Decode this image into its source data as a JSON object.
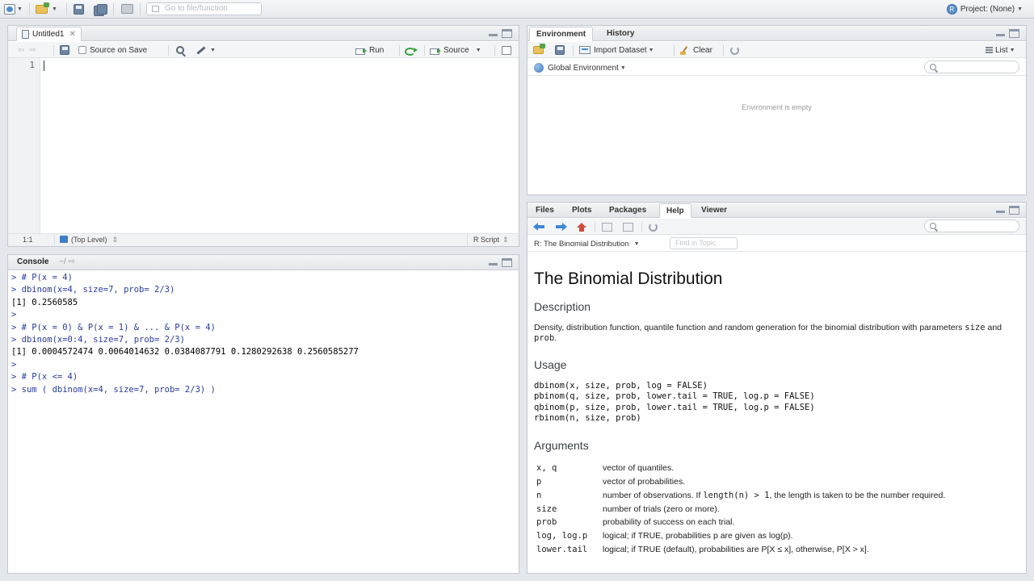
{
  "global_toolbar": {
    "goto_placeholder": "Go to file/function",
    "project_label": "Project: (None)",
    "project_icon_letter": "R"
  },
  "source": {
    "tab_label": "Untitled1",
    "source_on_save": "Source on Save",
    "run_label": "Run",
    "source_label": "Source",
    "line_numbers": [
      "1"
    ],
    "status_position": "1:1",
    "status_scope": "(Top Level)",
    "status_filetype": "R Script"
  },
  "console": {
    "title": "Console",
    "path": "~/",
    "lines": [
      {
        "kind": "in",
        "text": "> # P(x = 4)"
      },
      {
        "kind": "in",
        "text": "> dbinom(x=4, size=7, prob= 2/3)"
      },
      {
        "kind": "out",
        "text": "[1] 0.2560585"
      },
      {
        "kind": "in",
        "text": ">"
      },
      {
        "kind": "in",
        "text": "> # P(x = 0) & P(x = 1) & ... & P(x = 4)"
      },
      {
        "kind": "in",
        "text": "> dbinom(x=0:4, size=7, prob= 2/3)"
      },
      {
        "kind": "out",
        "text": "[1] 0.0004572474 0.0064014632 0.0384087791 0.1280292638 0.2560585277"
      },
      {
        "kind": "in",
        "text": ">"
      },
      {
        "kind": "in",
        "text": "> # P(x <= 4)"
      },
      {
        "kind": "in",
        "text": "> sum ( dbinom(x=4, size=7, prob= 2/3) )"
      }
    ]
  },
  "environment": {
    "tabs": [
      "Environment",
      "History"
    ],
    "import_label": "Import Dataset",
    "clear_label": "Clear",
    "view_label": "List",
    "scope_label": "Global Environment",
    "empty_message": "Environment is empty"
  },
  "help": {
    "tabs": [
      "Files",
      "Plots",
      "Packages",
      "Help",
      "Viewer"
    ],
    "topic_label": "R: The Binomial Distribution",
    "find_placeholder": "Find in Topic",
    "title": "The Binomial Distribution",
    "description_heading": "Description",
    "description_before": "Density, distribution function, quantile function and random generation for the binomial distribution with parameters ",
    "description_code1": "size",
    "description_and": " and ",
    "description_code2": "prob",
    "description_end": ".",
    "usage_heading": "Usage",
    "usage": "dbinom(x, size, prob, log = FALSE)\npbinom(q, size, prob, lower.tail = TRUE, log.p = FALSE)\nqbinom(p, size, prob, lower.tail = TRUE, log.p = FALSE)\nrbinom(n, size, prob)",
    "arguments_heading": "Arguments",
    "arguments": [
      {
        "name": "x, q",
        "desc": "vector of quantiles."
      },
      {
        "name": "p",
        "desc": "vector of probabilities."
      },
      {
        "name": "n",
        "desc_before": "number of observations. If ",
        "desc_code": "length(n) > 1",
        "desc_after": ", the length is taken to be the number required."
      },
      {
        "name": "size",
        "desc": "number of trials (zero or more)."
      },
      {
        "name": "prob",
        "desc": "probability of success on each trial."
      },
      {
        "name": "log, log.p",
        "desc": "logical; if TRUE, probabilities p are given as log(p)."
      },
      {
        "name": "lower.tail",
        "desc": "logical; if TRUE (default), probabilities are P[X ≤ x], otherwise, P[X > x]."
      }
    ]
  },
  "colors": {
    "console_input": "#2a3b9e",
    "console_output": "#000000",
    "pane_border": "#c4c9d0",
    "background": "#e4e7eb"
  }
}
